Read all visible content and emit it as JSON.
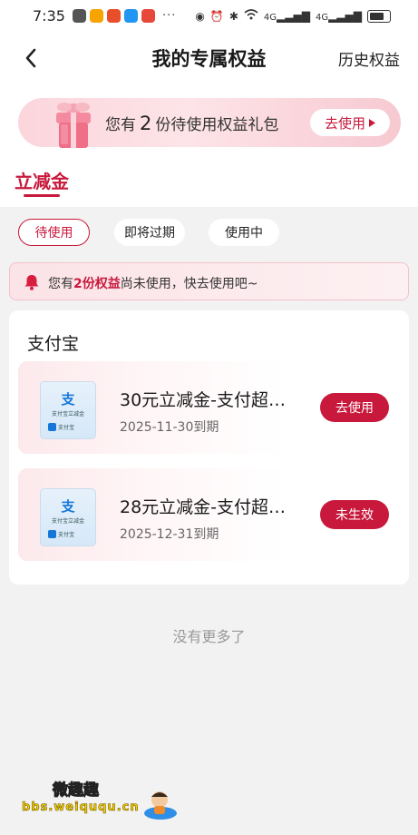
{
  "status_bar": {
    "time": "7:35",
    "more": "···",
    "app_icon_colors": [
      "#555555",
      "#f7a400",
      "#e84e2a",
      "#2196f3",
      "#e6483c"
    ],
    "signal_labels": [
      "4G",
      "4G"
    ]
  },
  "header": {
    "title": "我的专属权益",
    "history": "历史权益"
  },
  "banner": {
    "prefix": "您有",
    "count": "2",
    "suffix": "份待使用权益礼包",
    "button": "去使用"
  },
  "tab": {
    "label": "立减金"
  },
  "filters": [
    {
      "label": "待使用",
      "active": true
    },
    {
      "label": "即将过期",
      "active": false
    },
    {
      "label": "使用中",
      "active": false
    }
  ],
  "notice": {
    "prefix": "您有",
    "highlight": "2份权益",
    "suffix": "尚未使用，快去使用吧~"
  },
  "card": {
    "title": "支付宝",
    "coupons": [
      {
        "thumb_char": "支",
        "thumb_caption": "支付宝立减金",
        "thumb_brand": "支付宝",
        "name": "30元立减金-支付超…",
        "date": "2025-11-30到期",
        "button": "去使用"
      },
      {
        "thumb_char": "支",
        "thumb_caption": "支付宝立减金",
        "thumb_brand": "支付宝",
        "name": "28元立减金-支付超…",
        "date": "2025-12-31到期",
        "button": "未生效"
      }
    ]
  },
  "footer": {
    "no_more": "没有更多了"
  },
  "watermark": {
    "title": "微趣趣",
    "url": "bbs.weiququ.cn"
  },
  "colors": {
    "accent": "#c8193c",
    "page_bg": "#f2f2f2",
    "banner_pink": "#fbd6dc"
  }
}
